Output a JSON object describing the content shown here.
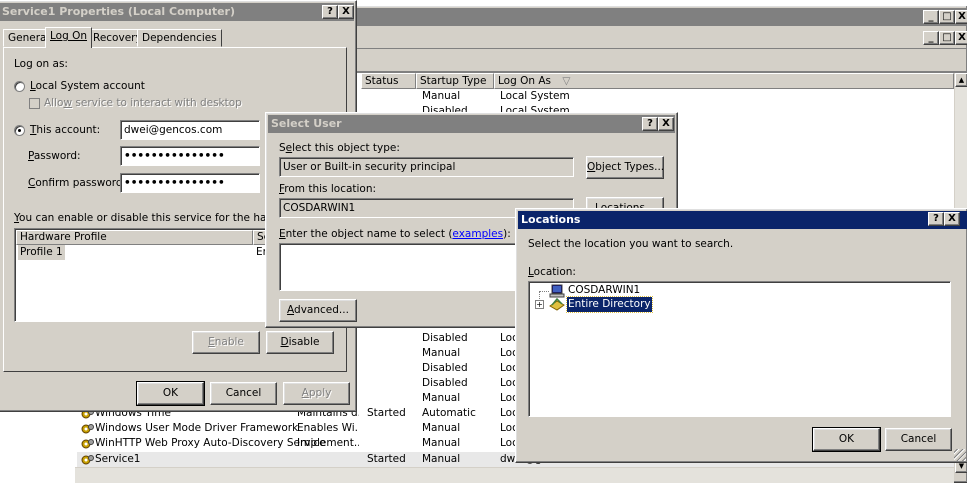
{
  "services_window": {
    "title": "",
    "columns": [
      "Status",
      "Startup Type",
      "Log On As"
    ],
    "sort_glyph": "▽",
    "top_rows": [
      {
        "startup": "Manual",
        "logon": "Local System"
      },
      {
        "startup": "Disabled",
        "logon": "Local System"
      }
    ],
    "mid_rows": [
      {
        "startup": "Disabled",
        "logon": "Loc"
      },
      {
        "startup": "Manual",
        "logon": "Loc"
      },
      {
        "startup": "Disabled",
        "logon": "Loc"
      },
      {
        "startup": "Disabled",
        "logon": "Loc"
      },
      {
        "startup": "Manual",
        "logon": "Loc"
      }
    ],
    "bottom_rows": [
      {
        "name": "Windows Time",
        "desc": "Maintains d...",
        "status": "Started",
        "startup": "Automatic",
        "logon": "Loc"
      },
      {
        "name": "Windows User Mode Driver Framework",
        "desc": "Enables Wi...",
        "status": "",
        "startup": "Manual",
        "logon": "Loc"
      },
      {
        "name": "WinHTTP Web Proxy Auto-Discovery Service",
        "desc": "Implement...",
        "status": "",
        "startup": "Manual",
        "logon": "Loc"
      },
      {
        "name": "Service1",
        "desc": "",
        "status": "Started",
        "startup": "Manual",
        "logon": "dwei@gencos.com"
      }
    ],
    "controls": {
      "minimize": "_",
      "restore": "□",
      "close": "X"
    }
  },
  "properties_dialog": {
    "title": "Service1 Properties (Local Computer)",
    "help": "?",
    "close": "X",
    "tabs": [
      "General",
      "Log On",
      "Recovery",
      "Dependencies"
    ],
    "log_on_as": "Log on as:",
    "local_system_prefix": "L",
    "local_system_rest": "ocal System account",
    "allow_interact_prefix": "Allo",
    "allow_interact_u": "w",
    "allow_interact_rest": " service to interact with desktop",
    "this_account_u": "T",
    "this_account_rest": "his account:",
    "account_value": "dwei@gencos.com",
    "password_u": "P",
    "password_rest": "assword:",
    "password_value": "•••••••••••••••",
    "confirm_u": "C",
    "confirm_rest": "onfirm password:",
    "confirm_value": "•••••••••••••••",
    "hw_text_u": "Y",
    "hw_text_rest": "ou can enable or disable this service for the hardware profi",
    "hw_columns": [
      "Hardware Profile",
      "Se"
    ],
    "hw_rows": [
      {
        "profile": "Profile 1",
        "status": "Er"
      }
    ],
    "enable_u": "E",
    "enable_rest": "nable",
    "disable_u": "D",
    "disable_rest": "isable",
    "ok": "OK",
    "cancel": "Cancel",
    "apply_u": "A",
    "apply_rest": "pply"
  },
  "select_user_dialog": {
    "title": "Select User",
    "help": "?",
    "close": "X",
    "object_type_label_prefix": "S",
    "object_type_label_u": "e",
    "object_type_label_rest": "lect this object type:",
    "object_type_value": "User or Built-in security principal",
    "object_types_btn_u": "O",
    "object_types_btn_rest": "bject Types...",
    "from_location_u": "F",
    "from_location_rest": "rom this location:",
    "location_value": "COSDARWIN1",
    "locations_btn_u": "L",
    "locations_btn_rest": "ocations...",
    "enter_name_u": "E",
    "enter_name_rest": "nter the object name to select (",
    "examples_link": "examples",
    "enter_name_end": "):",
    "advanced_u": "A",
    "advanced_rest": "dvanced..."
  },
  "locations_dialog": {
    "title": "Locations",
    "help": "?",
    "close": "X",
    "instruction": "Select the location you want to search.",
    "location_label_u": "L",
    "location_label_rest": "ocation:",
    "tree": [
      {
        "label": "COSDARWIN1",
        "selected": false,
        "expander": ""
      },
      {
        "label": "Entire Directory",
        "selected": true,
        "expander": "+"
      }
    ],
    "ok": "OK",
    "cancel": "Cancel"
  }
}
